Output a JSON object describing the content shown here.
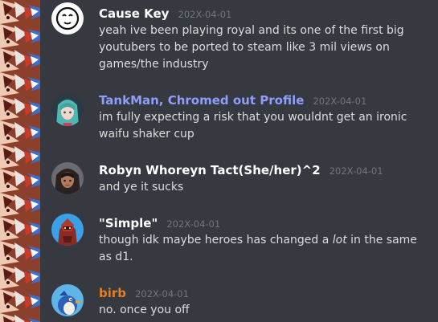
{
  "colors": {
    "background": "#36393f",
    "message_text": "#dcddde",
    "timestamp": "#72767d",
    "default_username": "#ffffff",
    "tankman_username": "#8e9dff",
    "birb_username": "#e67e22"
  },
  "messages": [
    {
      "username": "Cause Key",
      "timestamp": "202X-04-01",
      "text": "yeah ive been playing royal and its one of the first big youtubers to be ported to steam like 3 mil views on games/the industry",
      "avatar_icon": "white-face-avatar"
    },
    {
      "username": "TankMan, Chromed out Profile",
      "timestamp": "202X-04-01",
      "text": "im fully expecting a risk that you wouldnt get an ironic waifu shaker cup",
      "avatar_icon": "teal-hair-anime-avatar"
    },
    {
      "username": "Robyn Whoreyn Tact(She/her)^2",
      "timestamp": "202X-04-01",
      "text": "and ye it sucks",
      "avatar_icon": "dark-hair-anime-avatar"
    },
    {
      "username": "\"Simple\"",
      "timestamp": "202X-04-01",
      "text_before": "though idk maybe heroes has changed a ",
      "text_em": "lot",
      "text_after": " in the same as d1.",
      "avatar_icon": "red-armor-avatar"
    },
    {
      "username": "birb",
      "timestamp": "202X-04-01",
      "text": "no. once you off",
      "avatar_icon": "blue-bird-avatar"
    }
  ]
}
